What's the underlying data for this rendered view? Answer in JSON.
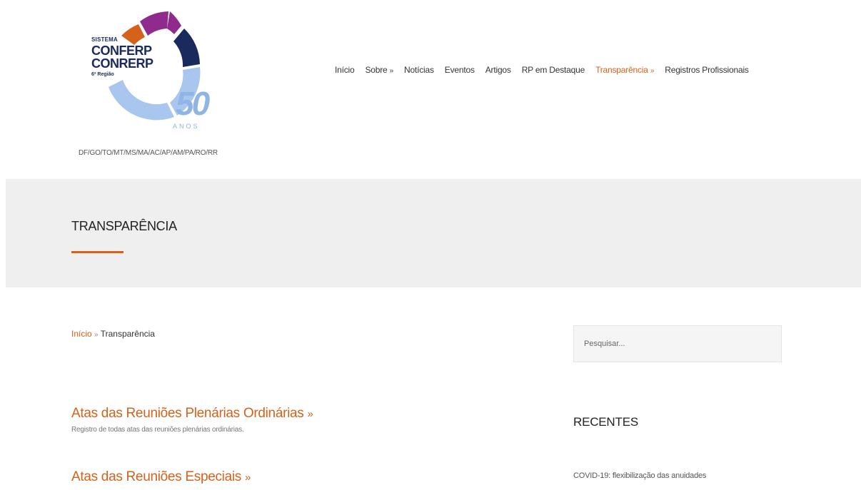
{
  "header": {
    "logo": {
      "sistema": "SISTEMA",
      "line1": "CONFERP",
      "line2": "CONRERP",
      "regiao": "6ª Região",
      "number": "50",
      "anos": "ANOS",
      "colors": {
        "orange": "#d4621b",
        "purple": "#8e2b8c",
        "navy": "#1b2a5c",
        "lightblue": "#a9c6ef"
      }
    },
    "tagline": "DF/GO/TO/MT/MS/MA/AC/AP/AM/PA/RO/RR"
  },
  "nav": {
    "items": [
      {
        "label": "Início",
        "has_submenu": false,
        "active": false
      },
      {
        "label": "Sobre",
        "has_submenu": true,
        "active": false
      },
      {
        "label": "Notícias",
        "has_submenu": false,
        "active": false
      },
      {
        "label": "Eventos",
        "has_submenu": false,
        "active": false
      },
      {
        "label": "Artigos",
        "has_submenu": false,
        "active": false
      },
      {
        "label": "RP em Destaque",
        "has_submenu": false,
        "active": false
      },
      {
        "label": "Transparência",
        "has_submenu": true,
        "active": true
      },
      {
        "label": "Registros Profissionais",
        "has_submenu": false,
        "active": false
      }
    ],
    "submenu_arrow": "»"
  },
  "banner": {
    "title": "TRANSPARÊNCIA"
  },
  "breadcrumb": {
    "home": "Início",
    "separator": "»",
    "current": "Transparência"
  },
  "sections": [
    {
      "title": "Atas das Reuniões Plenárias Ordinárias",
      "arrow": "»",
      "description": "Registro de todas atas das reuniões plenárias ordinárias."
    },
    {
      "title": "Atas das Reuniões Especiais",
      "arrow": "»",
      "description": ""
    }
  ],
  "sidebar": {
    "search_placeholder": "Pesquisar...",
    "recent_heading": "RECENTES",
    "recent_items": [
      "COVID-19: flexibilização das anuidades"
    ]
  },
  "accent_color": "#d4621b"
}
